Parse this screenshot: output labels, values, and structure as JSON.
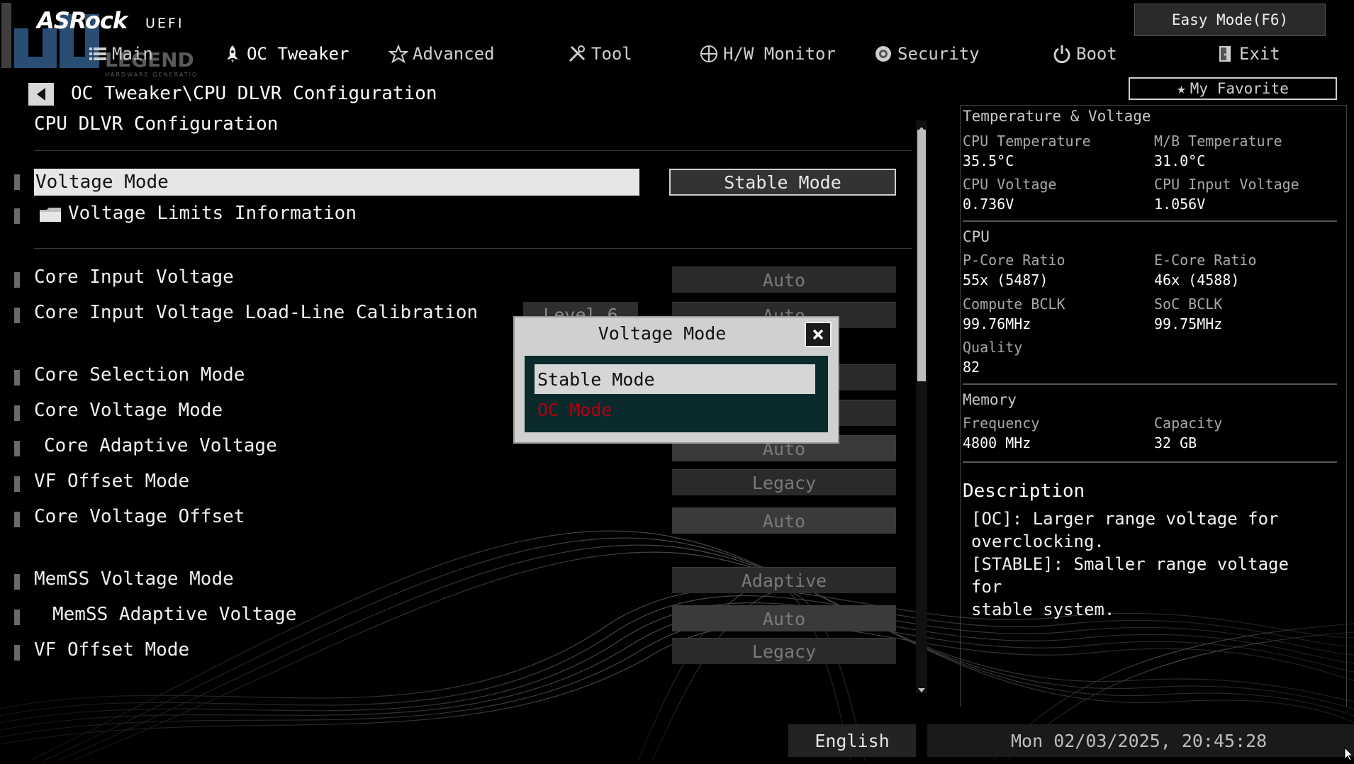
{
  "brand": {
    "name": "ASRock",
    "product": "UEFI"
  },
  "top_buttons": {
    "easy_mode": "Easy Mode(F6)",
    "my_favorite": "My Favorite"
  },
  "tabs": [
    {
      "label": "Main",
      "icon": "list-icon",
      "active": false
    },
    {
      "label": "OC Tweaker",
      "icon": "rocket-icon",
      "active": true
    },
    {
      "label": "Advanced",
      "icon": "star-icon",
      "active": false
    },
    {
      "label": "Tool",
      "icon": "tools-icon",
      "active": false
    },
    {
      "label": "H/W Monitor",
      "icon": "crosshair-icon",
      "active": false
    },
    {
      "label": "Security",
      "icon": "shield-icon",
      "active": false
    },
    {
      "label": "Boot",
      "icon": "power-icon",
      "active": false
    },
    {
      "label": "Exit",
      "icon": "exit-door-icon",
      "active": false
    }
  ],
  "breadcrumb": "OC Tweaker\\CPU DLVR Configuration",
  "page_title": "CPU DLVR Configuration",
  "settings": [
    {
      "label": "Voltage Mode",
      "value": "Stable Mode",
      "selected": true
    },
    {
      "label": "Voltage Limits Information",
      "folder": true
    },
    {
      "label": "Core Input Voltage",
      "value": "Auto"
    },
    {
      "label": "Core Input Voltage Load-Line Calibration",
      "value": "Auto",
      "extra": "Level 6"
    },
    {
      "label": "Core Selection Mode",
      "value": ""
    },
    {
      "label": "Core Voltage Mode",
      "value": ""
    },
    {
      "label": "Core Adaptive Voltage",
      "value": "Auto"
    },
    {
      "label": "VF Offset Mode",
      "value": "Legacy"
    },
    {
      "label": "Core Voltage Offset",
      "value": "Auto"
    },
    {
      "label": "MemSS Voltage Mode",
      "value": "Adaptive"
    },
    {
      "label": "MemSS Adaptive Voltage",
      "value": "Auto"
    },
    {
      "label": "VF Offset Mode",
      "value": "Legacy"
    }
  ],
  "modal": {
    "title": "Voltage Mode",
    "options": [
      "Stable Mode",
      "OC Mode"
    ],
    "selected": "Stable Mode"
  },
  "monitor": {
    "temp_voltage": {
      "heading": "Temperature & Voltage",
      "items": [
        {
          "label": "CPU Temperature",
          "value": "35.5°C"
        },
        {
          "label": "M/B Temperature",
          "value": "31.0°C"
        },
        {
          "label": "CPU Voltage",
          "value": "0.736V"
        },
        {
          "label": "CPU Input Voltage",
          "value": "1.056V"
        }
      ]
    },
    "cpu": {
      "heading": "CPU",
      "items": [
        {
          "label": "P-Core Ratio",
          "value": "55x (5487)"
        },
        {
          "label": "E-Core Ratio",
          "value": "46x (4588)"
        },
        {
          "label": "Compute BCLK",
          "value": "99.76MHz"
        },
        {
          "label": "SoC BCLK",
          "value": "99.75MHz"
        },
        {
          "label": "Quality",
          "value": "82"
        }
      ]
    },
    "memory": {
      "heading": "Memory",
      "items": [
        {
          "label": "Frequency",
          "value": "4800 MHz"
        },
        {
          "label": "Capacity",
          "value": "32 GB"
        }
      ]
    }
  },
  "description": {
    "title": "Description",
    "lines": [
      "[OC]: Larger range voltage for",
      "overclocking.",
      "[STABLE]: Smaller range voltage for",
      "stable system."
    ]
  },
  "footer": {
    "language": "English",
    "datetime": "Mon 02/03/2025, 20:45:28"
  },
  "watermark": {
    "text": "LEGEND",
    "subtext": "HARDWARE GENERATION"
  }
}
